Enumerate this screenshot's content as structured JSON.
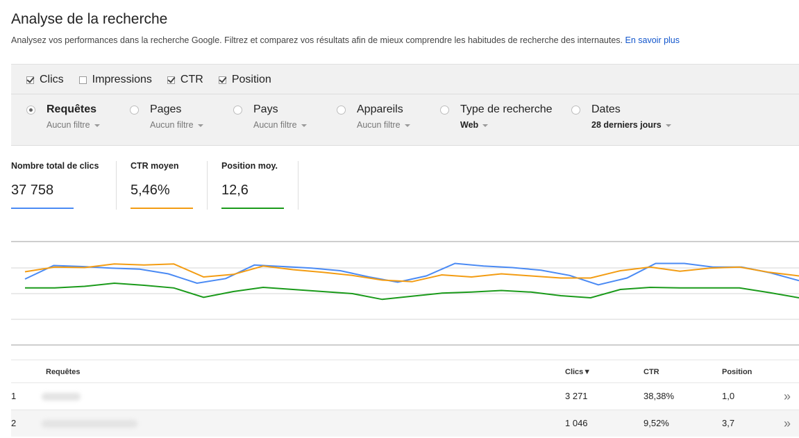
{
  "page": {
    "title": "Analyse de la recherche",
    "intro": "Analysez vos performances dans la recherche Google. Filtrez et comparez vos résultats afin de mieux comprendre les habitudes de recherche des internautes.",
    "learn_more": "En savoir plus"
  },
  "metrics": [
    {
      "label": "Clics",
      "checked": true
    },
    {
      "label": "Impressions",
      "checked": false
    },
    {
      "label": "CTR",
      "checked": true
    },
    {
      "label": "Position",
      "checked": true
    }
  ],
  "groups": [
    {
      "label": "Requêtes",
      "sub": "Aucun filtre",
      "selected": true
    },
    {
      "label": "Pages",
      "sub": "Aucun filtre",
      "selected": false
    },
    {
      "label": "Pays",
      "sub": "Aucun filtre",
      "selected": false
    },
    {
      "label": "Appareils",
      "sub": "Aucun filtre",
      "selected": false
    },
    {
      "label": "Type de recherche",
      "sub": "Web",
      "selected": false
    },
    {
      "label": "Dates",
      "sub": "28 derniers jours",
      "selected": false
    }
  ],
  "stats": [
    {
      "label": "Nombre total de clics",
      "value": "37 758",
      "color": "#4a8af4"
    },
    {
      "label": "CTR moyen",
      "value": "5,46%",
      "color": "#f39c12"
    },
    {
      "label": "Position moy.",
      "value": "12,6",
      "color": "#1a9a1a"
    }
  ],
  "chart_data": {
    "type": "line",
    "grid": true,
    "series": [
      {
        "color": "#4a8af4",
        "values": [
          0.72,
          0.46,
          0.48,
          0.51,
          0.53,
          0.62,
          0.8,
          0.71,
          0.45,
          0.48,
          0.51,
          0.56,
          0.68,
          0.78,
          0.66,
          0.42,
          0.47,
          0.5,
          0.55,
          0.65,
          0.83,
          0.7,
          0.42,
          0.42,
          0.49,
          0.49,
          0.6,
          0.75
        ]
      },
      {
        "color": "#f39c12",
        "values": [
          0.58,
          0.49,
          0.5,
          0.43,
          0.45,
          0.43,
          0.68,
          0.63,
          0.47,
          0.54,
          0.59,
          0.65,
          0.74,
          0.77,
          0.64,
          0.68,
          0.62,
          0.66,
          0.7,
          0.7,
          0.56,
          0.49,
          0.57,
          0.51,
          0.49,
          0.59,
          0.66
        ]
      },
      {
        "color": "#1a9a1a",
        "values": [
          0.89,
          0.89,
          0.86,
          0.8,
          0.84,
          0.89,
          1.07,
          0.96,
          0.88,
          0.92,
          0.96,
          1.0,
          1.11,
          1.05,
          0.99,
          0.97,
          0.94,
          0.97,
          1.04,
          1.08,
          0.92,
          0.88,
          0.89,
          0.89,
          0.89,
          0.98,
          1.08
        ]
      }
    ]
  },
  "table": {
    "headers": {
      "query": "Requêtes",
      "clicks": "Clics▼",
      "ctr": "CTR",
      "position": "Position"
    },
    "rows": [
      {
        "index": "1",
        "clicks": "3 271",
        "ctr": "38,38%",
        "position": "1,0"
      },
      {
        "index": "2",
        "clicks": "1 046",
        "ctr": "9,52%",
        "position": "3,7"
      }
    ],
    "more_icon": "»"
  }
}
